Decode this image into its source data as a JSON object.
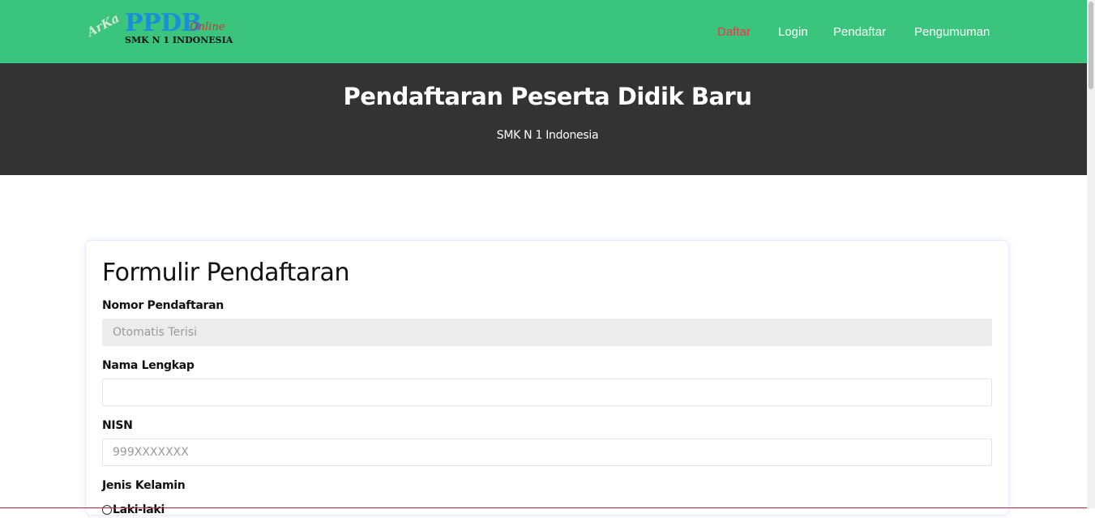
{
  "brand": {
    "arka": "ArKa",
    "ppdb": "PPDB",
    "online": "Online",
    "school": "SMK N 1 INDONESIA"
  },
  "nav": [
    {
      "label": "Daftar",
      "active": true
    },
    {
      "label": "Login",
      "active": false
    },
    {
      "label": "Pendaftar",
      "active": false
    },
    {
      "label": "Pengumuman",
      "active": false
    }
  ],
  "hero": {
    "title": "Pendaftaran Peserta Didik Baru",
    "subtitle": "SMK N 1 Indonesia"
  },
  "form": {
    "title": "Formulir Pendaftaran",
    "nomor": {
      "label": "Nomor Pendaftaran",
      "placeholder": "Otomatis Terisi",
      "value": ""
    },
    "nama": {
      "label": "Nama Lengkap",
      "placeholder": "",
      "value": ""
    },
    "nisn": {
      "label": "NISN",
      "placeholder": "999XXXXXXX",
      "value": ""
    },
    "jenis_kelamin": {
      "label": "Jenis Kelamin",
      "options": [
        "Laki-laki"
      ]
    }
  },
  "colors": {
    "navbar": "#3ac47d",
    "nav_active": "#e8394b",
    "hero_bg": "#333333"
  }
}
